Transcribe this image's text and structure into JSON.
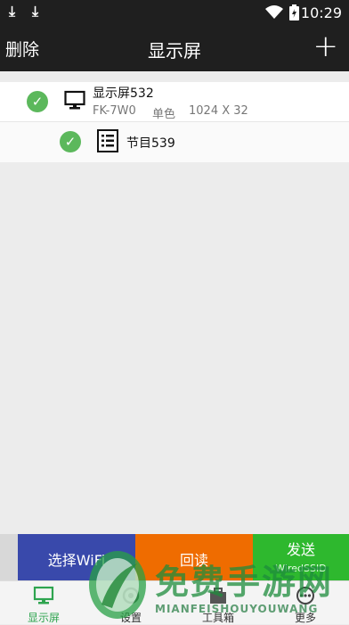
{
  "status_bar": {
    "time": "10:29",
    "icons": [
      "download-icon",
      "download-icon",
      "wifi-icon",
      "battery-icon"
    ]
  },
  "app_bar": {
    "left_action": "删除",
    "title": "显示屏",
    "right_action_icon": "plus-icon"
  },
  "screens": [
    {
      "name": "显示屏532",
      "model": "FK-7W0",
      "color_mode": "单色",
      "resolution": "1024 X 32"
    }
  ],
  "programs": [
    {
      "name": "节目539"
    }
  ],
  "action_buttons": {
    "select_wifi": "选择WiFi",
    "readback": "回读",
    "send": "发送",
    "send_sub": "WiredSSID"
  },
  "tabs": [
    {
      "label": "显示屏",
      "icon": "monitor-icon",
      "active": true
    },
    {
      "label": "设置",
      "icon": "settings-icon",
      "active": false
    },
    {
      "label": "工具箱",
      "icon": "toolbox-icon",
      "active": false
    },
    {
      "label": "更多",
      "icon": "more-icon",
      "active": false
    }
  ],
  "watermark": {
    "text": "免费手游网",
    "subtext": "MIANFEISHOUYOUWANG"
  },
  "colors": {
    "bar": "#1f1f1f",
    "check": "#5cb85c",
    "wifi_button": "#3949ab",
    "readback_button": "#ef6c00",
    "send_button": "#2eb82e",
    "active_tab": "#2ea44f"
  }
}
